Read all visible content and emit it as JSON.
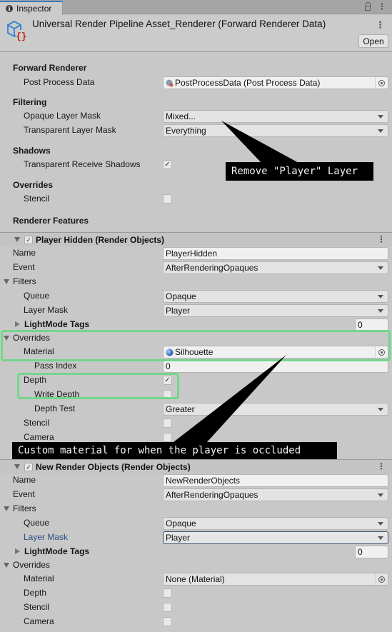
{
  "tab": {
    "icon": "info-icon",
    "label": "Inspector",
    "actions": [
      "lock-icon",
      "kebab-menu-icon"
    ]
  },
  "header": {
    "icon": "renderer-data-asset-icon",
    "title": "Universal Render Pipeline Asset_Renderer (Forward Renderer Data)",
    "open_label": "Open"
  },
  "forward_renderer": {
    "title": "Forward Renderer",
    "post_process_label": "Post Process Data",
    "post_process_value": "PostProcessData (Post Process Data)"
  },
  "filtering": {
    "title": "Filtering",
    "opaque_label": "Opaque Layer Mask",
    "opaque_value": "Mixed...",
    "transparent_label": "Transparent Layer Mask",
    "transparent_value": "Everything"
  },
  "shadows": {
    "title": "Shadows",
    "transparent_receive_label": "Transparent Receive Shadows",
    "transparent_receive_checked": true
  },
  "overrides": {
    "title": "Overrides",
    "stencil_label": "Stencil",
    "stencil_checked": false
  },
  "renderer_features": {
    "title": "Renderer Features",
    "features": [
      {
        "title": "Player Hidden (Render Objects)",
        "enabled": true,
        "name_label": "Name",
        "name_value": "PlayerHidden",
        "event_label": "Event",
        "event_value": "AfterRenderingOpaques",
        "filters_label": "Filters",
        "queue_label": "Queue",
        "queue_value": "Opaque",
        "layer_mask_label": "Layer Mask",
        "layer_mask_value": "Player",
        "lightmode_label": "LightMode Tags",
        "lightmode_count": "0",
        "overrides_label": "Overrides",
        "material_label": "Material",
        "material_value": "Silhouette",
        "pass_index_label": "Pass Index",
        "pass_index_value": "0",
        "depth_label": "Depth",
        "depth_checked": true,
        "write_depth_label": "Write Depth",
        "write_depth_checked": false,
        "depth_test_label": "Depth Test",
        "depth_test_value": "Greater",
        "stencil_label": "Stencil",
        "stencil_checked": false,
        "camera_label": "Camera",
        "camera_checked": false
      },
      {
        "title": "New Render Objects (Render Objects)",
        "enabled": true,
        "name_label": "Name",
        "name_value": "NewRenderObjects",
        "event_label": "Event",
        "event_value": "AfterRenderingOpaques",
        "filters_label": "Filters",
        "queue_label": "Queue",
        "queue_value": "Opaque",
        "layer_mask_label": "Layer Mask",
        "layer_mask_value": "Player",
        "lightmode_label": "LightMode Tags",
        "lightmode_count": "0",
        "overrides_label": "Overrides",
        "material_label": "Material",
        "material_value": "None (Material)",
        "depth_label": "Depth",
        "depth_checked": false,
        "stencil_label": "Stencil",
        "stencil_checked": false,
        "camera_label": "Camera",
        "camera_checked": false
      }
    ]
  },
  "annotations": {
    "remove_player_layer": "Remove \"Player\" Layer",
    "custom_material": "Custom material for when the player is occluded",
    "highlight_color": "#72d68b"
  },
  "colors": {
    "panel_bg": "#c8c8c8",
    "tab_accent": "#3a79bb",
    "focused_label": "#2a4e85"
  }
}
